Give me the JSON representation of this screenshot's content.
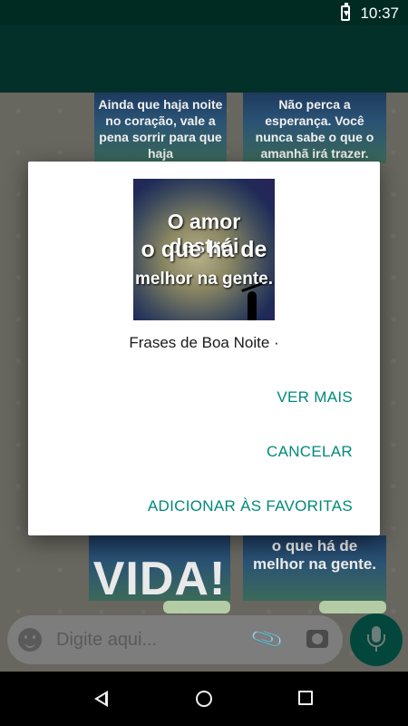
{
  "status_bar": {
    "time": "10:37"
  },
  "chat": {
    "stickers": [
      {
        "text": "Ainda que haja noite no coração, vale a pena sorrir para que haja"
      },
      {
        "text": "Não perca a esperança. Você nunca sabe o que o amanhã irá trazer."
      },
      {
        "text": "VIDA!"
      },
      {
        "text": "o que há de melhor na gente."
      }
    ]
  },
  "input": {
    "placeholder": "Digite aqui..."
  },
  "dialog": {
    "image_lines": [
      "O amor destrói",
      "o que há de",
      "melhor na gente."
    ],
    "title": "Frases de Boa Noite ·",
    "buttons": {
      "more": "VER MAIS",
      "cancel": "CANCELAR",
      "favorite": "ADICIONAR ÀS FAVORITAS"
    }
  },
  "colors": {
    "accent": "#00897b",
    "app_bar": "#03312a",
    "status_bar": "#002b23"
  }
}
